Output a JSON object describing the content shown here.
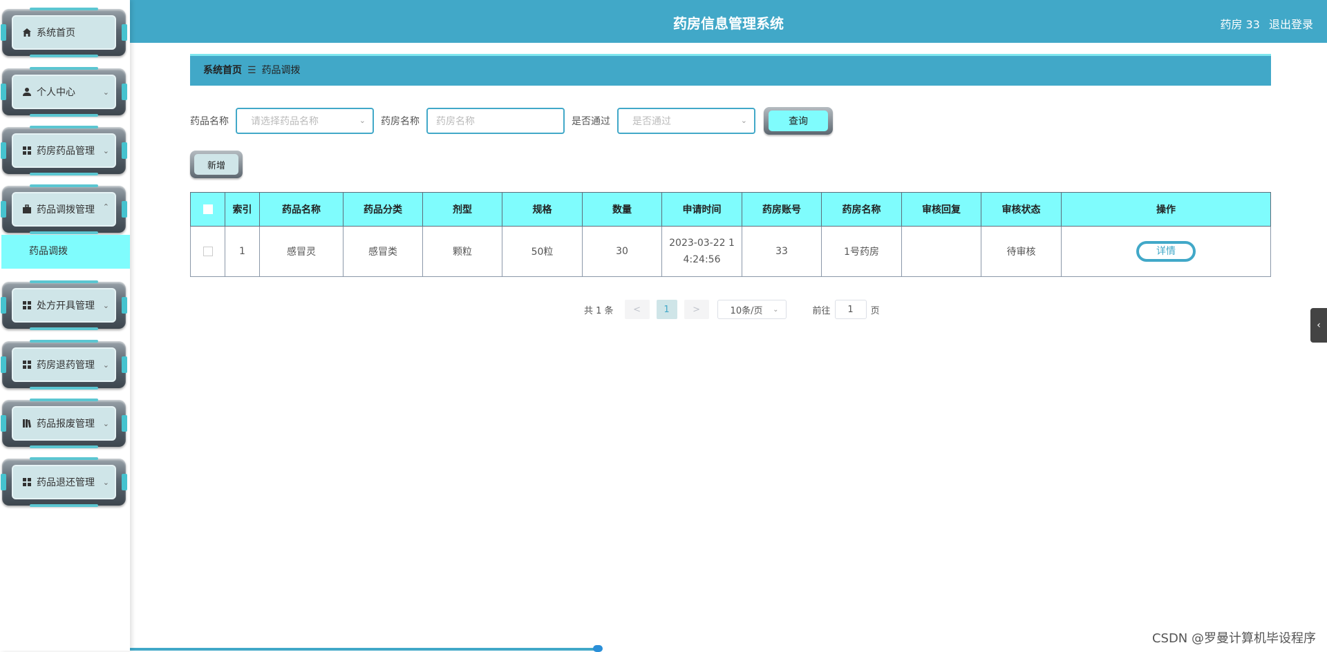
{
  "header": {
    "title": "药房信息管理系统",
    "user": "药房 33",
    "logout": "退出登录"
  },
  "sidebar": {
    "items": [
      {
        "label": "系统首页",
        "icon": "home-icon"
      },
      {
        "label": "个人中心",
        "icon": "user-icon"
      },
      {
        "label": "药房药品管理",
        "icon": "grid-icon"
      },
      {
        "label": "药品调拨管理",
        "icon": "briefcase-icon",
        "expanded": true
      },
      {
        "label": "处方开具管理",
        "icon": "grid-icon"
      },
      {
        "label": "药房退药管理",
        "icon": "grid-icon"
      },
      {
        "label": "药品报废管理",
        "icon": "book-icon"
      },
      {
        "label": "药品退还管理",
        "icon": "grid-icon"
      }
    ],
    "submenu": {
      "label": "药品调拨"
    }
  },
  "breadcrumb": {
    "home": "系统首页",
    "sep": "☰",
    "current": "药品调拨"
  },
  "search": {
    "drug_name_label": "药品名称",
    "drug_name_placeholder": "请选择药品名称",
    "pharmacy_name_label": "药房名称",
    "pharmacy_name_placeholder": "药房名称",
    "passed_label": "是否通过",
    "passed_placeholder": "是否通过",
    "query_button": "查询"
  },
  "add_button": "新增",
  "table": {
    "headers": [
      "索引",
      "药品名称",
      "药品分类",
      "剂型",
      "规格",
      "数量",
      "申请时间",
      "药房账号",
      "药房名称",
      "审核回复",
      "审核状态",
      "操作"
    ],
    "rows": [
      {
        "index": "1",
        "drug_name": "感冒灵",
        "category": "感冒类",
        "dosage_form": "颗粒",
        "spec": "50粒",
        "quantity": "30",
        "apply_time": "2023-03-22 1",
        "apply_time2": "4:24:56",
        "account": "33",
        "pharmacy": "1号药房",
        "reply": "",
        "status": "待审核",
        "action": "详情"
      }
    ]
  },
  "pagination": {
    "total": "共 1 条",
    "prev": "<",
    "page": "1",
    "next": ">",
    "page_size": "10条/页",
    "goto": "前往",
    "goto_value": "1",
    "page_unit": "页"
  },
  "toggle": "‹",
  "watermark": "CSDN @罗曼计算机毕设程序",
  "colors": {
    "primary": "#41a8c8",
    "accent": "#7ffcfd",
    "menu_bg": "#cfe5e8"
  }
}
